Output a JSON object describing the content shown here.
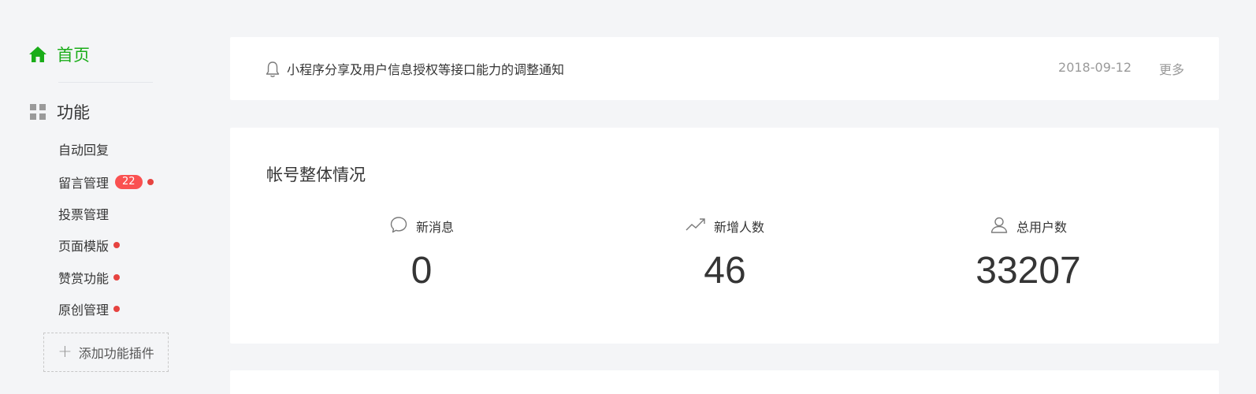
{
  "sidebar": {
    "home": {
      "label": "首页",
      "icon": "home-icon",
      "color": "#1aad19"
    },
    "section": {
      "label": "功能",
      "icon": "grid-icon"
    },
    "items": [
      {
        "label": "自动回复"
      },
      {
        "label": "留言管理",
        "badge": "22",
        "dot": true
      },
      {
        "label": "投票管理"
      },
      {
        "label": "页面模版",
        "dot": true
      },
      {
        "label": "赞赏功能",
        "dot": true
      },
      {
        "label": "原创管理",
        "dot": true
      }
    ],
    "add_plugin": {
      "label": "添加功能插件",
      "icon": "plus-icon"
    }
  },
  "notice": {
    "icon": "bell-icon",
    "title": "小程序分享及用户信息授权等接口能力的调整通知",
    "date": "2018-09-12",
    "more": "更多"
  },
  "overview": {
    "title": "帐号整体情况",
    "stats": [
      {
        "label": "新消息",
        "icon": "message-icon",
        "value": "0"
      },
      {
        "label": "新增人数",
        "icon": "trend-up-icon",
        "value": "46"
      },
      {
        "label": "总用户数",
        "icon": "user-icon",
        "value": "33207"
      }
    ]
  },
  "colors": {
    "accent": "#1aad19",
    "badge": "#fa5151",
    "dot": "#e64340",
    "background": "#f4f5f7"
  }
}
